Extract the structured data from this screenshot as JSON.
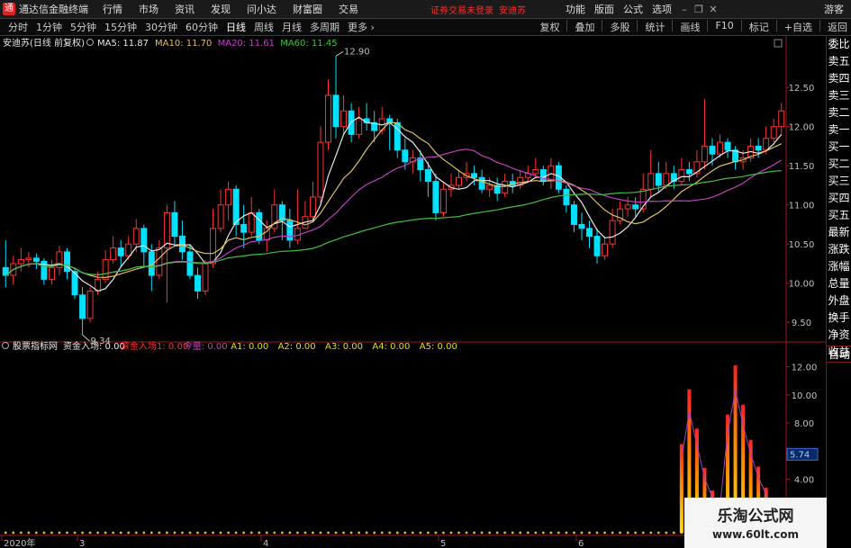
{
  "window": {
    "app_title": "通达信金融终端",
    "menu": [
      "行情",
      "市场",
      "资讯",
      "发现",
      "问小达",
      "财富圈",
      "交易"
    ],
    "login_notice": "证券交易未登录",
    "stock_name": "安迪苏",
    "right_menu": [
      "功能",
      "版面",
      "公式",
      "选项"
    ],
    "guest": "游客",
    "window_buttons": [
      "–",
      "❐",
      "✕"
    ]
  },
  "periods": [
    {
      "label": "分时",
      "active": false
    },
    {
      "label": "1分钟",
      "active": false
    },
    {
      "label": "5分钟",
      "active": false
    },
    {
      "label": "15分钟",
      "active": false
    },
    {
      "label": "30分钟",
      "active": false
    },
    {
      "label": "60分钟",
      "active": false
    },
    {
      "label": "日线",
      "active": true
    },
    {
      "label": "周线",
      "active": false
    },
    {
      "label": "月线",
      "active": false
    },
    {
      "label": "多周期",
      "active": false
    },
    {
      "label": "更多 ›",
      "active": false
    }
  ],
  "toolbar": [
    "复权",
    "叠加",
    "多股",
    "统计",
    "画线",
    "F10",
    "标记",
    "+自选",
    "返回"
  ],
  "side_panel": [
    "委比",
    "卖五",
    "卖四",
    "卖三",
    "卖二",
    "卖一",
    "买一",
    "买二",
    "买三",
    "买四",
    "买五",
    "最新",
    "涨跌",
    "涨幅",
    "总量",
    "外盘",
    "换手",
    "净资",
    "收益"
  ],
  "side_auto": "自动",
  "main_legend": {
    "title": "安迪苏(日线 前复权)",
    "items": [
      {
        "text": "MA5: 11.87",
        "color": "#e8e8e8"
      },
      {
        "text": "MA10: 11.70",
        "color": "#e0c060"
      },
      {
        "text": "MA20: 11.61",
        "color": "#c040c0"
      },
      {
        "text": "MA60: 11.45",
        "color": "#40c040"
      }
    ]
  },
  "sub_legend": {
    "title": "股票指标网",
    "items": [
      {
        "text": "资金入场: 0.00",
        "color": "#e8e8e8"
      },
      {
        "text": "资金入场1: 0.00",
        "color": "#ff3030"
      },
      {
        "text": "今量: 0.00",
        "color": "#c040c0"
      },
      {
        "text": "A1: 0.00",
        "color": "#e0e000"
      },
      {
        "text": "A2: 0.00",
        "color": "#e0e000"
      },
      {
        "text": "A3: 0.00",
        "color": "#e0e000"
      },
      {
        "text": "A4: 0.00",
        "color": "#e0e000"
      },
      {
        "text": "A5: 0.00",
        "color": "#e0e000"
      }
    ]
  },
  "watermark": {
    "title": "乐淘公式网",
    "url": "www.60lt.com"
  },
  "colors": {
    "up": "#ff3232",
    "down": "#00e0ff",
    "axis": "#a01818",
    "ma5": "#e8e8e8",
    "ma10": "#e0c060",
    "ma20": "#c040c0",
    "ma60": "#40c040"
  },
  "chart_data": [
    {
      "type": "candlestick",
      "title": "安迪苏(日线 前复权)",
      "y_ticks": [
        "12.50",
        "12.00",
        "11.50",
        "11.00",
        "10.50",
        "10.00",
        "9.50"
      ],
      "ylim": [
        9.25,
        12.95
      ],
      "annotations": [
        {
          "text": "12.90",
          "index": 43,
          "value": 12.9
        },
        {
          "text": "9.34",
          "index": 10,
          "value": 9.34
        }
      ],
      "candles": [
        [
          10.2,
          10.1,
          10.55,
          9.95
        ],
        [
          10.1,
          10.25,
          10.35,
          9.98
        ],
        [
          10.25,
          10.3,
          10.45,
          10.15
        ],
        [
          10.3,
          10.32,
          10.4,
          10.2
        ],
        [
          10.32,
          10.28,
          10.38,
          10.18
        ],
        [
          10.28,
          10.05,
          10.32,
          9.98
        ],
        [
          10.05,
          10.2,
          10.3,
          9.98
        ],
        [
          10.2,
          10.4,
          10.48,
          10.1
        ],
        [
          10.4,
          10.15,
          10.45,
          10.05
        ],
        [
          10.15,
          9.85,
          10.2,
          9.8
        ],
        [
          9.85,
          9.55,
          9.95,
          9.34
        ],
        [
          9.55,
          9.9,
          9.95,
          9.5
        ],
        [
          9.9,
          10.05,
          10.15,
          9.85
        ],
        [
          10.05,
          10.3,
          10.42,
          10.0
        ],
        [
          10.3,
          10.45,
          10.6,
          10.25
        ],
        [
          10.45,
          10.35,
          10.55,
          10.22
        ],
        [
          10.35,
          10.5,
          10.6,
          10.3
        ],
        [
          10.5,
          10.7,
          10.82,
          10.4
        ],
        [
          10.7,
          10.4,
          10.75,
          10.2
        ],
        [
          10.4,
          10.1,
          10.5,
          9.9
        ],
        [
          10.1,
          10.45,
          10.55,
          10.05
        ],
        [
          10.45,
          10.9,
          11.0,
          9.75
        ],
        [
          10.9,
          10.6,
          11.05,
          10.5
        ],
        [
          10.6,
          10.4,
          10.8,
          10.3
        ],
        [
          10.4,
          10.1,
          10.5,
          10.05
        ],
        [
          10.1,
          9.9,
          10.2,
          9.8
        ],
        [
          9.9,
          10.25,
          10.3,
          9.85
        ],
        [
          10.25,
          10.7,
          10.95,
          10.2
        ],
        [
          10.7,
          11.0,
          11.2,
          10.65
        ],
        [
          11.0,
          11.2,
          11.3,
          10.8
        ],
        [
          11.2,
          10.75,
          11.25,
          10.6
        ],
        [
          10.75,
          10.65,
          11.0,
          10.45
        ],
        [
          10.65,
          10.9,
          11.1,
          10.6
        ],
        [
          10.9,
          10.55,
          10.95,
          10.5
        ],
        [
          10.55,
          10.7,
          10.8,
          10.4
        ],
        [
          10.7,
          11.0,
          11.2,
          10.65
        ],
        [
          11.0,
          10.8,
          11.05,
          10.55
        ],
        [
          10.8,
          10.55,
          10.95,
          10.45
        ],
        [
          10.55,
          10.7,
          11.2,
          10.5
        ],
        [
          10.7,
          10.85,
          11.05,
          10.7
        ],
        [
          10.85,
          11.1,
          11.3,
          10.8
        ],
        [
          11.1,
          11.8,
          12.0,
          11.0
        ],
        [
          11.8,
          12.4,
          12.6,
          11.7
        ],
        [
          12.4,
          12.0,
          12.9,
          11.85
        ],
        [
          12.0,
          12.2,
          12.4,
          11.9
        ],
        [
          12.2,
          11.9,
          12.3,
          11.8
        ],
        [
          11.9,
          12.1,
          12.25,
          11.85
        ],
        [
          12.1,
          12.05,
          12.3,
          11.95
        ],
        [
          12.05,
          11.95,
          12.2,
          11.8
        ],
        [
          11.95,
          12.1,
          12.25,
          11.9
        ],
        [
          12.1,
          12.05,
          12.15,
          11.7
        ],
        [
          12.05,
          11.7,
          12.1,
          11.6
        ],
        [
          11.7,
          11.55,
          11.85,
          11.45
        ],
        [
          11.55,
          11.6,
          11.7,
          11.4
        ],
        [
          11.6,
          11.45,
          11.7,
          11.3
        ],
        [
          11.45,
          11.3,
          11.55,
          11.1
        ],
        [
          11.3,
          10.9,
          11.4,
          10.8
        ],
        [
          10.9,
          11.2,
          11.3,
          10.85
        ],
        [
          11.2,
          11.25,
          11.4,
          11.1
        ],
        [
          11.25,
          11.35,
          11.45,
          11.2
        ],
        [
          11.35,
          11.4,
          11.55,
          11.3
        ],
        [
          11.4,
          11.35,
          11.5,
          11.25
        ],
        [
          11.35,
          11.2,
          11.45,
          11.15
        ],
        [
          11.2,
          11.25,
          11.35,
          11.1
        ],
        [
          11.25,
          11.15,
          11.35,
          11.05
        ],
        [
          11.15,
          11.3,
          11.4,
          11.1
        ],
        [
          11.3,
          11.25,
          11.4,
          11.15
        ],
        [
          11.25,
          11.35,
          11.45,
          11.2
        ],
        [
          11.35,
          11.4,
          11.5,
          11.3
        ],
        [
          11.4,
          11.45,
          11.6,
          11.35
        ],
        [
          11.45,
          11.3,
          11.5,
          11.25
        ],
        [
          11.3,
          11.5,
          11.6,
          11.2
        ],
        [
          11.5,
          11.2,
          11.55,
          11.15
        ],
        [
          11.2,
          11.0,
          11.25,
          10.9
        ],
        [
          11.0,
          10.75,
          11.05,
          10.65
        ],
        [
          10.75,
          10.7,
          10.9,
          10.55
        ],
        [
          10.7,
          10.6,
          10.8,
          10.45
        ],
        [
          10.6,
          10.35,
          10.7,
          10.25
        ],
        [
          10.35,
          10.5,
          10.6,
          10.3
        ],
        [
          10.5,
          10.8,
          10.95,
          10.45
        ],
        [
          10.8,
          10.95,
          11.05,
          10.75
        ],
        [
          10.95,
          11.0,
          11.1,
          10.85
        ],
        [
          11.0,
          10.95,
          11.1,
          10.85
        ],
        [
          10.95,
          11.2,
          11.4,
          10.9
        ],
        [
          11.2,
          11.4,
          11.7,
          11.1
        ],
        [
          11.4,
          11.25,
          11.55,
          11.15
        ],
        [
          11.25,
          11.4,
          11.55,
          11.2
        ],
        [
          11.4,
          11.3,
          11.5,
          11.2
        ],
        [
          11.3,
          11.45,
          11.6,
          11.25
        ],
        [
          11.45,
          11.4,
          11.55,
          11.3
        ],
        [
          11.4,
          11.55,
          11.7,
          11.35
        ],
        [
          11.55,
          11.75,
          12.35,
          11.45
        ],
        [
          11.75,
          11.65,
          11.85,
          11.5
        ],
        [
          11.65,
          11.8,
          11.9,
          11.6
        ],
        [
          11.8,
          11.7,
          11.85,
          11.6
        ],
        [
          11.7,
          11.55,
          11.75,
          11.45
        ],
        [
          11.55,
          11.6,
          11.7,
          11.45
        ],
        [
          11.6,
          11.75,
          11.85,
          11.55
        ],
        [
          11.75,
          11.7,
          11.85,
          11.6
        ],
        [
          11.7,
          11.85,
          12.0,
          11.65
        ],
        [
          11.85,
          12.0,
          12.1,
          11.8
        ],
        [
          12.0,
          12.2,
          12.3,
          11.9
        ]
      ]
    },
    {
      "type": "bar",
      "title": "资金入场",
      "y_ticks": [
        "12.00",
        "10.00",
        "8.00",
        "6.00",
        "4.00"
      ],
      "ylim": [
        0,
        13
      ],
      "badge": "5.74",
      "x_labels": [
        "2020年",
        "3",
        "4",
        "5",
        "6"
      ],
      "values_start_index": 88,
      "values": [
        6.5,
        10.4,
        7.6,
        4.8,
        3.2,
        2.4,
        8.6,
        12.1,
        9.3,
        6.8,
        4.9,
        3.4,
        2.3,
        1.7,
        1.3,
        1.0,
        0.8,
        0.7,
        0.6,
        0.55,
        0.5,
        0.45,
        0.4,
        0.35,
        0.3,
        0.3,
        0.28
      ]
    }
  ]
}
